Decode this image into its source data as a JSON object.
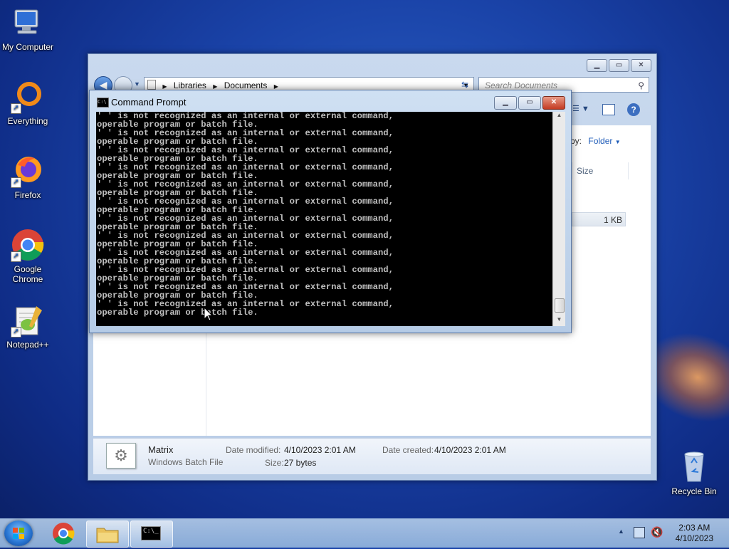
{
  "desktop": {
    "icons": [
      {
        "label": "My Computer",
        "icon": "computer-icon"
      },
      {
        "label": "Everything",
        "icon": "everything-icon"
      },
      {
        "label": "Firefox",
        "icon": "firefox-icon"
      },
      {
        "label": "Google Chrome",
        "icon": "chrome-icon"
      },
      {
        "label": "Notepad++",
        "icon": "notepadpp-icon"
      },
      {
        "label": "Recycle Bin",
        "icon": "recycle-bin-icon"
      }
    ]
  },
  "explorer": {
    "breadcrumb": [
      "Libraries",
      "Documents"
    ],
    "search_placeholder": "Search Documents",
    "arrange_by_label": "by:",
    "arrange_by_value": "Folder",
    "column_size": "Size",
    "file_size": "1 KB",
    "details": {
      "name": "Matrix",
      "type": "Windows Batch File",
      "date_modified_label": "Date modified:",
      "date_modified": "4/10/2023 2:01 AM",
      "date_created_label": "Date created:",
      "date_created": "4/10/2023 2:01 AM",
      "size_label": "Size:",
      "size": "27 bytes"
    }
  },
  "cmd": {
    "title": "Command Prompt",
    "output": "' ' is not recognized as an internal or external command,\noperable program or batch file.\n' ' is not recognized as an internal or external command,\noperable program or batch file.\n' ' is not recognized as an internal or external command,\noperable program or batch file.\n' ' is not recognized as an internal or external command,\noperable program or batch file.\n' ' is not recognized as an internal or external command,\noperable program or batch file.\n' ' is not recognized as an internal or external command,\noperable program or batch file.\n' ' is not recognized as an internal or external command,\noperable program or batch file.\n' ' is not recognized as an internal or external command,\noperable program or batch file.\n' ' is not recognized as an internal or external command,\noperable program or batch file.\n' ' is not recognized as an internal or external command,\noperable program or batch file.\n' ' is not recognized as an internal or external command,\noperable program or batch file.\n' ' is not recognized as an internal or external command,\noperable program or batch file."
  },
  "taskbar": {
    "time": "2:03 AM",
    "date": "4/10/2023"
  }
}
